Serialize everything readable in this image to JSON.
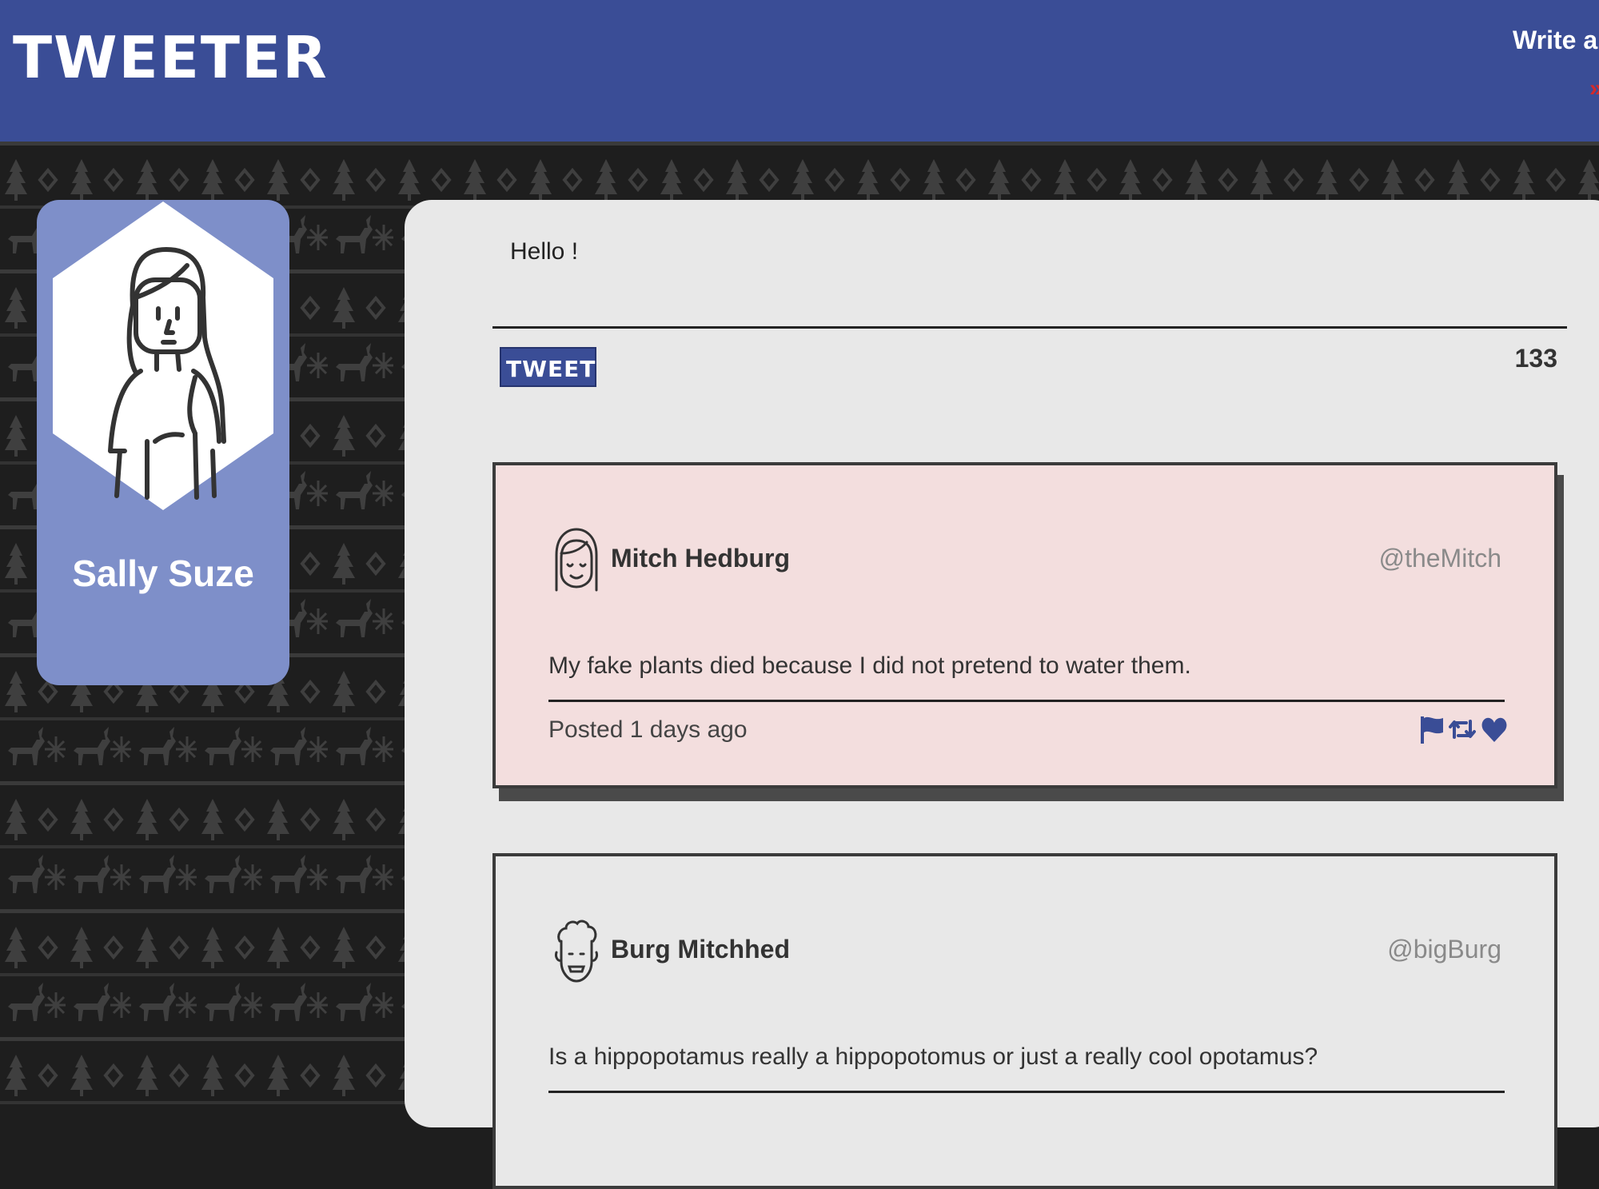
{
  "header": {
    "logo": "TWEETER",
    "write_link": "Write a n",
    "accent_red": "#d32a2a",
    "bar_color": "#3a4d96"
  },
  "profile": {
    "name": "Sally Suze",
    "avatar_icon": "woman-avatar-icon"
  },
  "compose": {
    "text": "Hello !",
    "button_label": "TWEET",
    "char_counter": "133"
  },
  "tweets": [
    {
      "user": "Mitch Hedburg",
      "handle": "@theMitch",
      "text": "My fake plants died because I did not pretend to water them.",
      "posted": "Posted 1 days ago",
      "avatar_icon": "girl-avatar-icon",
      "actions": [
        "flag-icon",
        "retweet-icon",
        "heart-icon"
      ]
    },
    {
      "user": "Burg Mitchhed",
      "handle": "@bigBurg",
      "text": "Is a hippopotamus really a hippopotomus or just a really cool opotamus?",
      "avatar_icon": "curly-hair-avatar-icon"
    }
  ]
}
